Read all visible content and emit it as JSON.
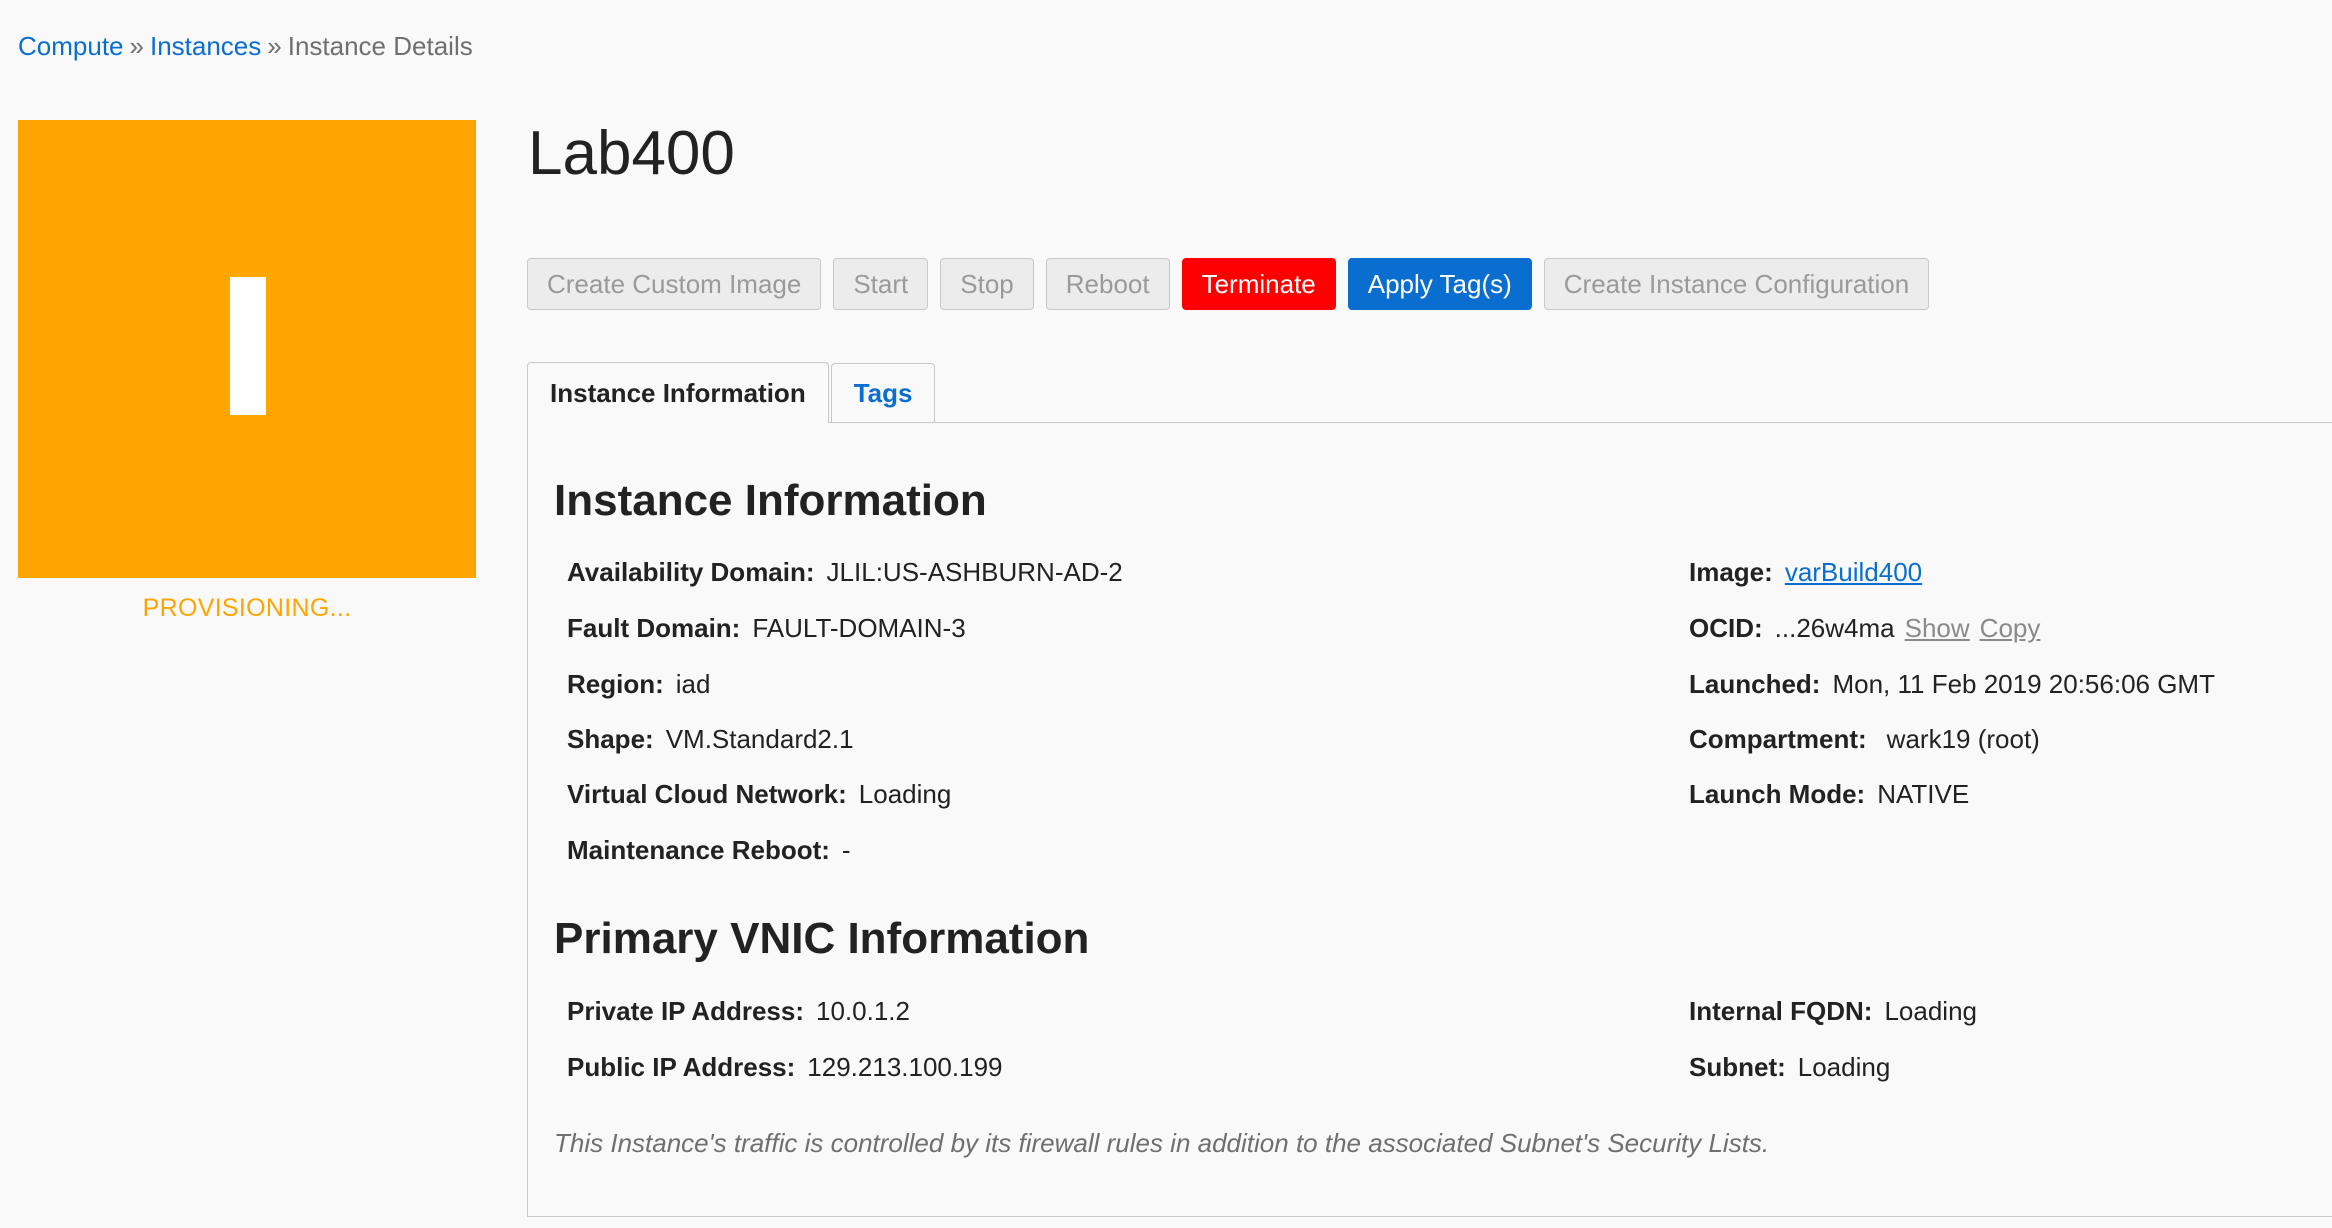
{
  "breadcrumb": {
    "items": [
      "Compute",
      "Instances",
      "Instance Details"
    ],
    "separator": "»"
  },
  "status": {
    "label": "PROVISIONING...",
    "color": "#ffa500",
    "glyph": "I"
  },
  "title": "Lab400",
  "toolbar": {
    "create_custom_image": "Create Custom Image",
    "start": "Start",
    "stop": "Stop",
    "reboot": "Reboot",
    "terminate": "Terminate",
    "apply_tags": "Apply Tag(s)",
    "create_instance_configuration": "Create Instance Configuration"
  },
  "tabs": {
    "instance_information": "Instance Information",
    "tags": "Tags"
  },
  "instance_info": {
    "heading": "Instance Information",
    "left": [
      {
        "label": "Availability Domain:",
        "value": "JLIL:US-ASHBURN-AD-2"
      },
      {
        "label": "Fault Domain:",
        "value": "FAULT-DOMAIN-3"
      },
      {
        "label": "Region:",
        "value": "iad"
      },
      {
        "label": "Shape:",
        "value": "VM.Standard2.1"
      },
      {
        "label": "Virtual Cloud Network:",
        "value": "Loading"
      },
      {
        "label": "Maintenance Reboot:",
        "value": "-"
      }
    ],
    "image": {
      "label": "Image:",
      "value": "varBuild400"
    },
    "ocid": {
      "label": "OCID:",
      "value": "...26w4ma",
      "show": "Show",
      "copy": "Copy"
    },
    "launched": {
      "label": "Launched:",
      "value": "Mon, 11 Feb 2019 20:56:06 GMT"
    },
    "compartment": {
      "label": "Compartment:",
      "value": "wark19 (root)"
    },
    "launch_mode": {
      "label": "Launch Mode:",
      "value": "NATIVE"
    }
  },
  "vnic_info": {
    "heading": "Primary VNIC Information",
    "private_ip": {
      "label": "Private IP Address:",
      "value": "10.0.1.2"
    },
    "public_ip": {
      "label": "Public IP Address:",
      "value": "129.213.100.199"
    },
    "internal_fqdn": {
      "label": "Internal FQDN:",
      "value": "Loading"
    },
    "subnet": {
      "label": "Subnet:",
      "value": "Loading"
    }
  },
  "note": "This Instance's traffic is controlled by its firewall rules in addition to the associated Subnet's Security Lists."
}
